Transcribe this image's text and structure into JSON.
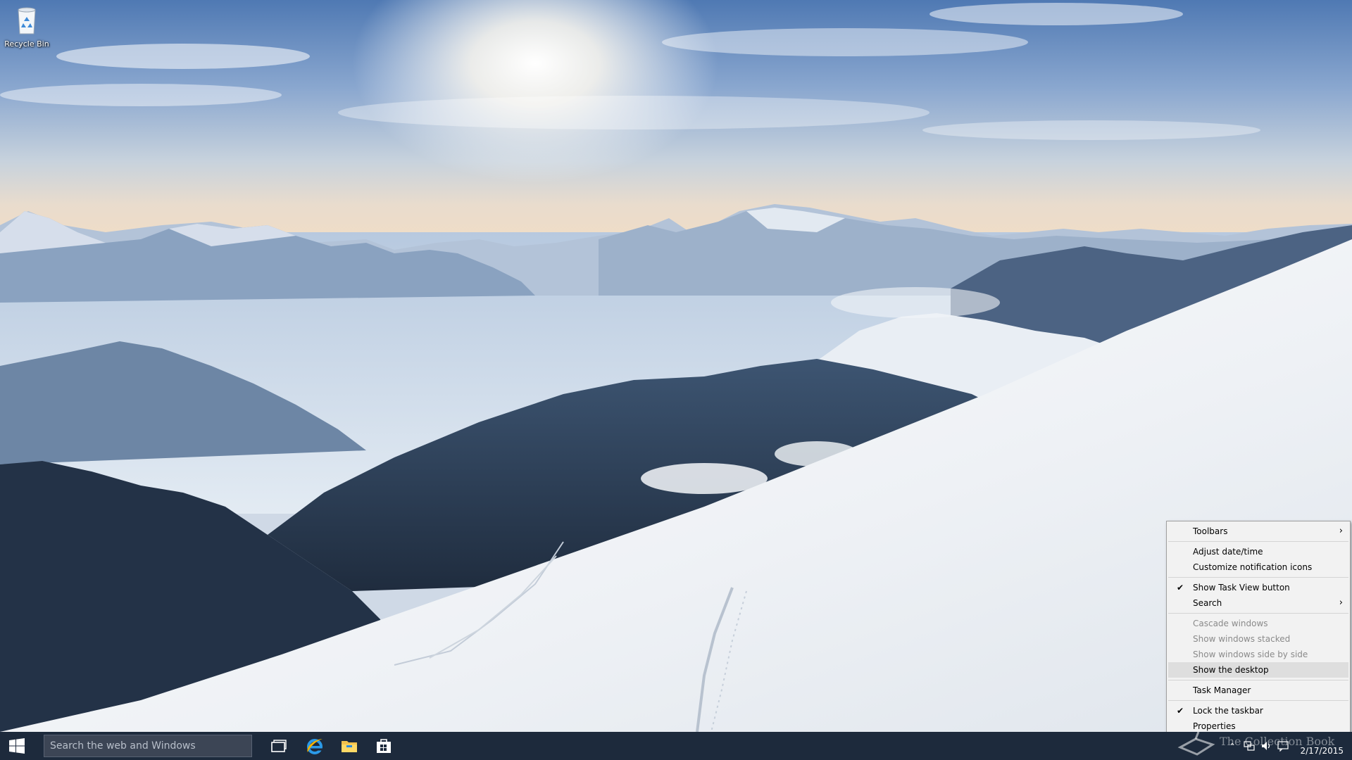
{
  "desktop": {
    "icons": [
      {
        "label": "Recycle Bin",
        "icon": "recycle-bin-icon"
      }
    ]
  },
  "context_menu": {
    "items": [
      {
        "label": "Toolbars",
        "submenu": true,
        "checked": false,
        "disabled": false
      },
      {
        "separator": true
      },
      {
        "label": "Adjust date/time",
        "checked": false,
        "disabled": false
      },
      {
        "label": "Customize notification icons",
        "checked": false,
        "disabled": false
      },
      {
        "separator": true
      },
      {
        "label": "Show Task View button",
        "checked": true,
        "disabled": false
      },
      {
        "label": "Search",
        "submenu": true,
        "checked": false,
        "disabled": false
      },
      {
        "separator": true
      },
      {
        "label": "Cascade windows",
        "checked": false,
        "disabled": true
      },
      {
        "label": "Show windows stacked",
        "checked": false,
        "disabled": true
      },
      {
        "label": "Show windows side by side",
        "checked": false,
        "disabled": true
      },
      {
        "label": "Show the desktop",
        "checked": false,
        "disabled": false,
        "highlighted": true
      },
      {
        "separator": true
      },
      {
        "label": "Task Manager",
        "checked": false,
        "disabled": false
      },
      {
        "separator": true
      },
      {
        "label": "Lock the taskbar",
        "checked": true,
        "disabled": false
      },
      {
        "label": "Properties",
        "checked": false,
        "disabled": false
      }
    ]
  },
  "taskbar": {
    "search_placeholder": "Search the web and Windows",
    "apps": [
      {
        "name": "task-view",
        "icon": "task-view-icon"
      },
      {
        "name": "internet-explorer",
        "icon": "internet-explorer-icon"
      },
      {
        "name": "file-explorer",
        "icon": "file-explorer-icon"
      },
      {
        "name": "store",
        "icon": "store-icon"
      }
    ],
    "clock": {
      "time": "",
      "date": "2/17/2015"
    },
    "watermark": "The Collection Book"
  },
  "colors": {
    "taskbar": "#1d2a3c",
    "menu_bg": "#f2f2f2",
    "menu_highlight": "#dedede",
    "disabled_text": "#8a8a8a"
  }
}
